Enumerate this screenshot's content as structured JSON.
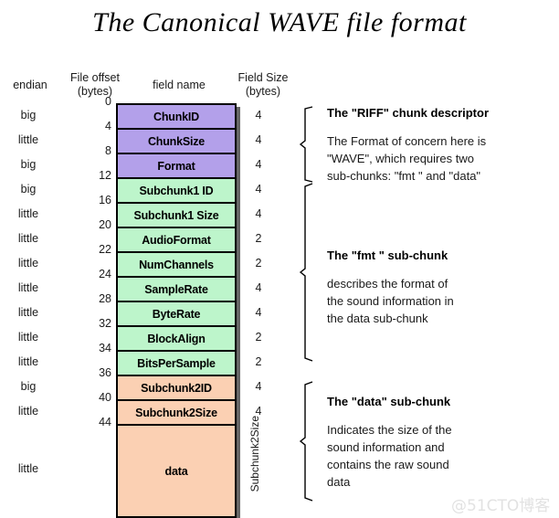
{
  "title": "The Canonical WAVE file format",
  "watermark": "@51CTO博客",
  "colors": {
    "riff_chunk": "#b3a0ea",
    "fmt_subchunk": "#bdf5cb",
    "data_subchunk": "#fbd0b3",
    "border": "#000000",
    "shadow": "#666666"
  },
  "headers": {
    "endian": "endian",
    "file_offset_line1": "File offset",
    "file_offset_line2": "(bytes)",
    "field_name": "field name",
    "field_size_line1": "Field Size",
    "field_size_line2": "(bytes)"
  },
  "vertical_label": "Subchunk2Size",
  "rows": [
    {
      "endian": "big",
      "offset": "0",
      "name": "ChunkID",
      "size": "4",
      "group": "riff"
    },
    {
      "endian": "little",
      "offset": "4",
      "name": "ChunkSize",
      "size": "4",
      "group": "riff"
    },
    {
      "endian": "big",
      "offset": "8",
      "name": "Format",
      "size": "4",
      "group": "riff"
    },
    {
      "endian": "big",
      "offset": "12",
      "name": "Subchunk1 ID",
      "size": "4",
      "group": "fmt"
    },
    {
      "endian": "little",
      "offset": "16",
      "name": "Subchunk1 Size",
      "size": "4",
      "group": "fmt"
    },
    {
      "endian": "little",
      "offset": "20",
      "name": "AudioFormat",
      "size": "2",
      "group": "fmt"
    },
    {
      "endian": "little",
      "offset": "22",
      "name": "NumChannels",
      "size": "2",
      "group": "fmt"
    },
    {
      "endian": "little",
      "offset": "24",
      "name": "SampleRate",
      "size": "4",
      "group": "fmt"
    },
    {
      "endian": "little",
      "offset": "28",
      "name": "ByteRate",
      "size": "4",
      "group": "fmt"
    },
    {
      "endian": "little",
      "offset": "32",
      "name": "BlockAlign",
      "size": "2",
      "group": "fmt"
    },
    {
      "endian": "little",
      "offset": "34",
      "name": "BitsPerSample",
      "size": "2",
      "group": "fmt"
    },
    {
      "endian": "big",
      "offset": "36",
      "name": "Subchunk2ID",
      "size": "4",
      "group": "data"
    },
    {
      "endian": "little",
      "offset": "40",
      "name": "Subchunk2Size",
      "size": "4",
      "group": "data"
    },
    {
      "endian": "little",
      "offset": "44",
      "name": "data",
      "size": "",
      "group": "data"
    }
  ],
  "annotations": [
    {
      "title": "The \"RIFF\" chunk descriptor",
      "lines": [
        "The Format of concern here is",
        "\"WAVE\", which requires two",
        "sub-chunks: \"fmt \" and \"data\""
      ]
    },
    {
      "title": "The \"fmt \" sub-chunk",
      "lines": [
        "describes the format of",
        "the sound information in",
        "the data sub-chunk"
      ]
    },
    {
      "title": "The \"data\" sub-chunk",
      "lines": [
        "Indicates the size of the",
        "sound information and",
        "contains the raw sound",
        "data"
      ]
    }
  ]
}
